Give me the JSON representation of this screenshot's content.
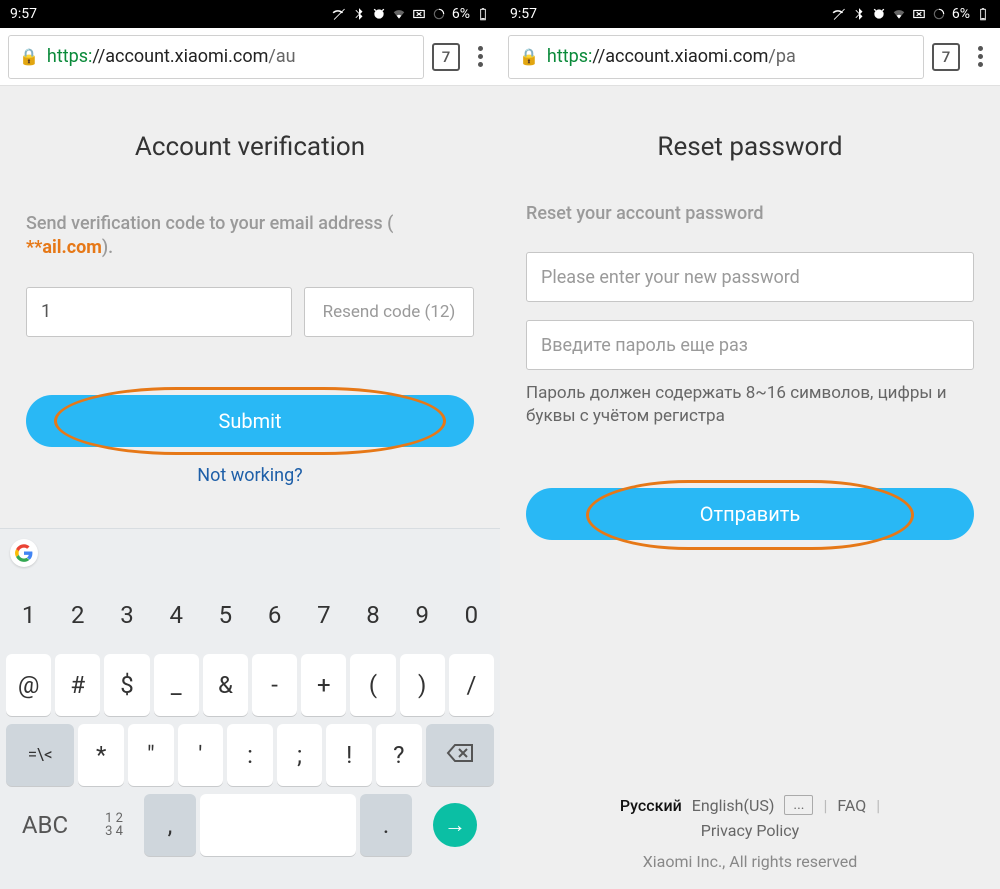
{
  "statusbar": {
    "time": "9:57",
    "battery": "6%"
  },
  "browser": {
    "left": {
      "proto": "https:",
      "domain": "//account.xiaomi.com",
      "path": "/au"
    },
    "right": {
      "proto": "https:",
      "domain": "//account.xiaomi.com",
      "path": "/pa"
    },
    "tabcount": "7"
  },
  "left": {
    "title": "Account verification",
    "prompt_a": "Send verification code to your email address (",
    "email": "        **ail.com",
    "prompt_b": ").",
    "code_value": "1",
    "resend_label": "Resend code (12)",
    "submit": "Submit",
    "not_working": "Not working?"
  },
  "right": {
    "title": "Reset password",
    "subtitle": "Reset your account password",
    "pw1_placeholder": "Please enter your new password",
    "pw2_placeholder": "Введите пароль еще раз",
    "hint": "Пароль должен содержать 8~16 символов, цифры и буквы с учётом регистра",
    "submit": "Отправить"
  },
  "footer": {
    "lang_ru": "Русский",
    "lang_en": "English(US)",
    "more": "...",
    "faq": "FAQ",
    "privacy": "Privacy Policy",
    "copyright": "Xiaomi Inc., All rights reserved"
  },
  "keyboard": {
    "row1": [
      "1",
      "2",
      "3",
      "4",
      "5",
      "6",
      "7",
      "8",
      "9",
      "0"
    ],
    "row2": [
      "@",
      "#",
      "$",
      "_",
      "&",
      "-",
      "+",
      "(",
      ")",
      "/"
    ],
    "row3_sym": "=\\<",
    "row3": [
      "*",
      "\"",
      "'",
      ":",
      ";",
      "!",
      "?"
    ],
    "abc": "ABC",
    "twoline_a": "1 2",
    "twoline_b": "3 4",
    "comma": ",",
    "period": "."
  }
}
